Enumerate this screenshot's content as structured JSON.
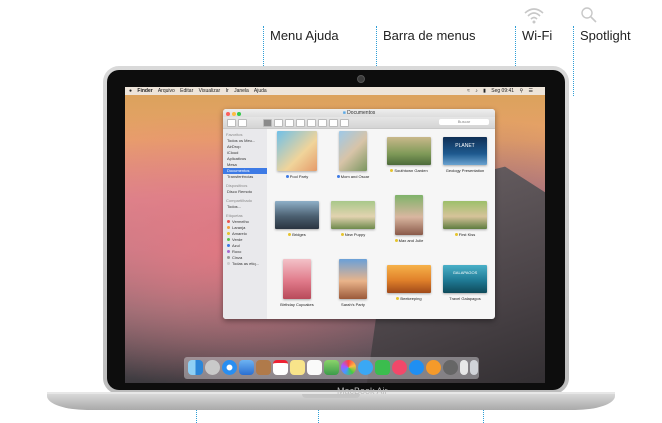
{
  "callouts": {
    "menu_ajuda": "Menu Ajuda",
    "barra_menus": "Barra de menus",
    "wifi": "Wi-Fi",
    "spotlight": "Spotlight"
  },
  "laptop": {
    "model_label": "MacBook Air"
  },
  "menubar": {
    "items": [
      "Finder",
      "Arquivo",
      "Editar",
      "Visualizar",
      "Ir",
      "Janela",
      "Ajuda"
    ],
    "clock": "Seg 09:41"
  },
  "window": {
    "title": "Documentos",
    "search_placeholder": "Buscar",
    "sidebar": {
      "favorites_header": "Favoritos",
      "favorites": [
        "Todos os Meu...",
        "AirDrop",
        "iCloud",
        "Aplicativos",
        "Mesa",
        "Documentos",
        "Transferências"
      ],
      "devices_header": "Dispositivos",
      "devices": [
        "Disco Remoto"
      ],
      "shared_header": "Compartilhado",
      "shared": [
        "Todos..."
      ],
      "tags_header": "Etiquetas",
      "tags": [
        "Vermelho",
        "Laranja",
        "Amarelo",
        "Verde",
        "Azul",
        "Roxo",
        "Cinza",
        "Todas as etiq..."
      ]
    },
    "files": [
      {
        "name": "Pool Party",
        "tag_color": "#3d7ae5"
      },
      {
        "name": "Mom and Oscar",
        "tag_color": "#3d7ae5"
      },
      {
        "name": "Southtown Garden",
        "tag_color": "#e6c42d"
      },
      {
        "name": "Geology Presentation",
        "tag_color": ""
      },
      {
        "name": "Bridges",
        "tag_color": "#e6c42d"
      },
      {
        "name": "New Puppy",
        "tag_color": "#e6c42d"
      },
      {
        "name": "Max and Julie",
        "tag_color": "#e6c42d"
      },
      {
        "name": "First Kiss",
        "tag_color": "#e6c42d"
      },
      {
        "name": "Birthday Cupcakes",
        "tag_color": ""
      },
      {
        "name": "Sarah's Party",
        "tag_color": ""
      },
      {
        "name": "Beekeeping",
        "tag_color": "#e6c42d"
      },
      {
        "name": "Travel Galapagos",
        "tag_color": ""
      }
    ]
  },
  "colors": {
    "accent": "#2f9fd6",
    "selection": "#3d7ae5"
  }
}
